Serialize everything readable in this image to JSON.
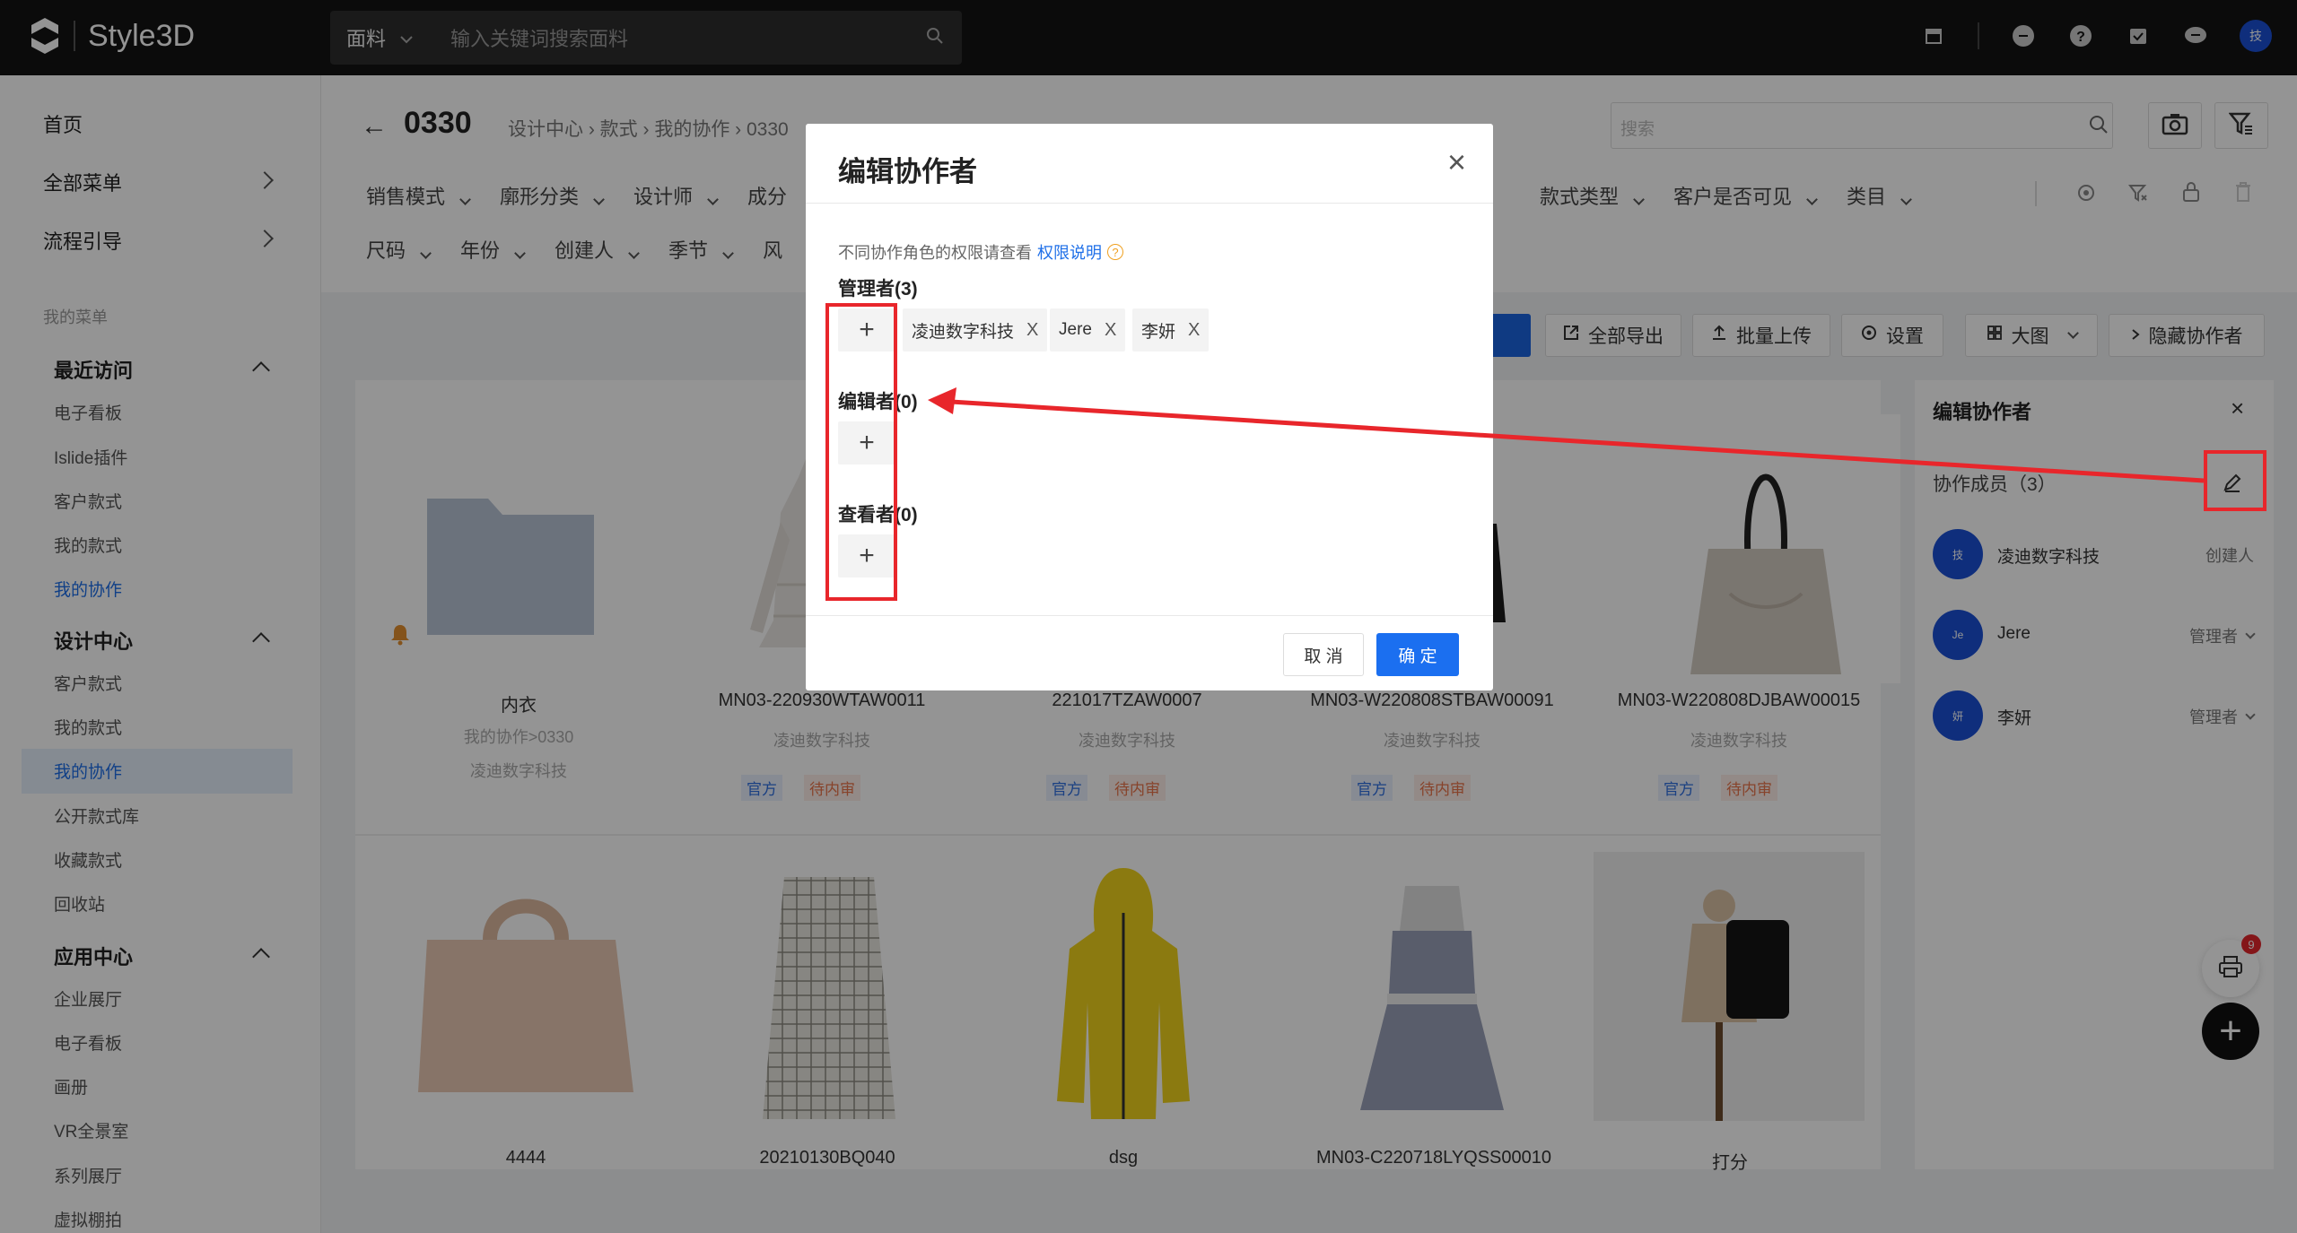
{
  "app": {
    "brand": "Style3D"
  },
  "topbar": {
    "search_category": "面料",
    "search_placeholder": "输入关键词搜索面料",
    "avatar": "技"
  },
  "sidebar": {
    "home": "首页",
    "all_menu": "全部菜单",
    "flow_guide": "流程引导",
    "my_menu": "我的菜单",
    "groups": [
      {
        "title": "最近访问",
        "items": [
          "电子看板",
          "Islide插件",
          "客户款式",
          "我的款式",
          "我的协作"
        ]
      },
      {
        "title": "设计中心",
        "items": [
          "客户款式",
          "我的款式",
          "我的协作",
          "公开款式库",
          "收藏款式",
          "回收站"
        ]
      },
      {
        "title": "应用中心",
        "items": [
          "企业展厅",
          "电子看板",
          "画册",
          "VR全景室",
          "系列展厅",
          "虚拟棚拍"
        ]
      }
    ]
  },
  "page": {
    "back": "←",
    "title": "0330",
    "breadcrumb": "设计中心 › 款式 › 我的协作 › 0330",
    "search_placeholder": "搜索",
    "filters_row1_left": [
      "销售模式",
      "廓形分类",
      "设计师",
      "成分"
    ],
    "filters_row1_right": [
      "款式类型",
      "客户是否可见",
      "类目"
    ],
    "filters_row2": [
      "尺码",
      "年份",
      "创建人",
      "季节",
      "风"
    ]
  },
  "toolbar": {
    "export_all": "全部导出",
    "batch_upload": "批量上传",
    "settings": "设置",
    "large_view": "大图",
    "hide_collab": "隐藏协作者"
  },
  "cards_row1": [
    {
      "name": "内衣",
      "sub1": "我的协作>0330",
      "sub2": "凌迪数字科技",
      "tags": []
    },
    {
      "name": "MN03-220930WTAW0011",
      "sub2": "凌迪数字科技",
      "tags": [
        "官方",
        "待内审"
      ]
    },
    {
      "name": "221017TZAW0007",
      "sub2": "凌迪数字科技",
      "tags": [
        "官方",
        "待内审"
      ]
    },
    {
      "name": "MN03-W220808STBAW00091",
      "sub2": "凌迪数字科技",
      "tags": [
        "官方",
        "待内审"
      ]
    },
    {
      "name": "MN03-W220808DJBAW00015",
      "sub2": "凌迪数字科技",
      "tags": [
        "官方",
        "待内审"
      ]
    }
  ],
  "cards_row2": [
    {
      "name": "4444"
    },
    {
      "name": "20210130BQ040"
    },
    {
      "name": "dsg"
    },
    {
      "name": "MN03-C220718LYQSS00010"
    },
    {
      "name": "打分"
    }
  ],
  "right_panel": {
    "title": "编辑协作者",
    "close": "×",
    "members_label": "协作成员（3）",
    "members": [
      {
        "avatar": "技",
        "name": "凌迪数字科技",
        "role": "创建人"
      },
      {
        "avatar": "Je",
        "name": "Jere",
        "role": "管理者"
      },
      {
        "avatar": "妍",
        "name": "李妍",
        "role": "管理者"
      }
    ]
  },
  "fab": {
    "badge": "9",
    "add": "+"
  },
  "modal": {
    "title": "编辑协作者",
    "close": "×",
    "hint": "不同协作角色的权限请查看",
    "hint_link": "权限说明",
    "hint_q": "?",
    "managers_label": "管理者(3)",
    "managers": [
      "凌迪数字科技",
      "Jere",
      "李妍"
    ],
    "editors_label": "编辑者(0)",
    "viewers_label": "查看者(0)",
    "add": "+",
    "chip_x": "X",
    "cancel": "取 消",
    "ok": "确 定"
  },
  "colors": {
    "accent": "#1b6ff0",
    "annotation": "#e8262b"
  }
}
